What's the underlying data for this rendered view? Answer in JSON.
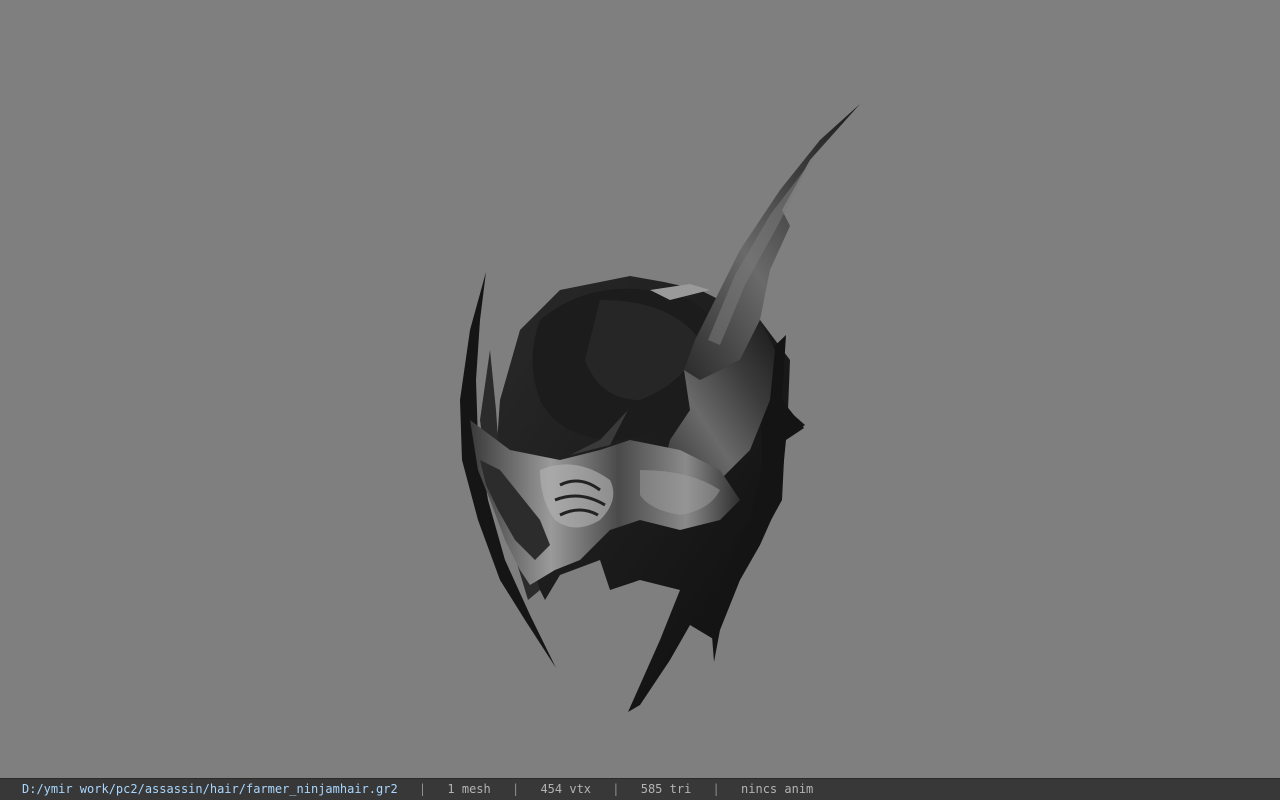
{
  "viewport": {
    "background_color": "#7f7f7f",
    "model_name": "farmer_ninjamhair"
  },
  "statusbar": {
    "file_path": "D:/ymir work/pc2/assassin/hair/farmer_ninjamhair.gr2",
    "separator": "|",
    "mesh_count": "1 mesh",
    "vertex_count": "454 vtx",
    "triangle_count": "585 tri",
    "animation": "nincs anim",
    "path_color": "#a9d6ff",
    "text_color": "#b3b3b3"
  }
}
